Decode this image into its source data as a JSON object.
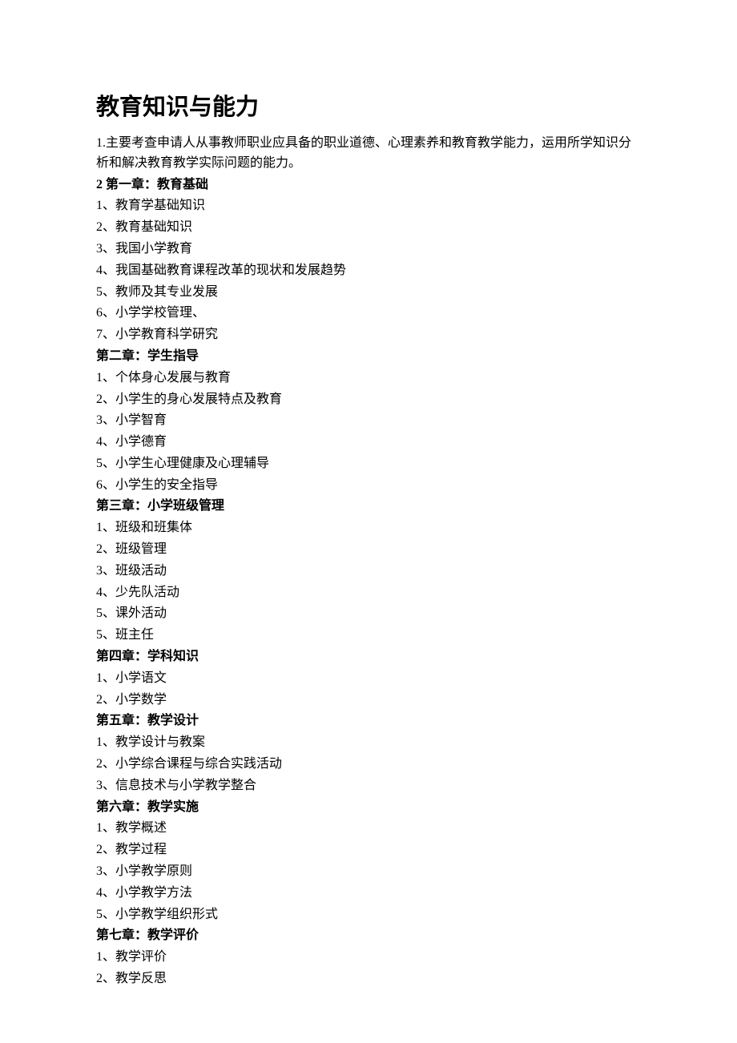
{
  "title": "教育知识与能力",
  "intro": "1.主要考查申请人从事教师职业应具备的职业道德、心理素养和教育教学能力，运用所学知识分析和解决教育教学实际问题的能力。",
  "chapters": [
    {
      "heading": "2 第一章：教育基础",
      "items": [
        "1、教育学基础知识",
        "2、教育基础知识",
        "3、我国小学教育",
        "4、我国基础教育课程改革的现状和发展趋势",
        "5、教师及其专业发展",
        "6、小学学校管理、",
        "7、小学教育科学研究"
      ]
    },
    {
      "heading": "第二章：学生指导",
      "items": [
        "1、个体身心发展与教育",
        "2、小学生的身心发展特点及教育",
        "3、小学智育",
        "4、小学德育",
        "5、小学生心理健康及心理辅导",
        "6、小学生的安全指导"
      ]
    },
    {
      "heading": "第三章：小学班级管理",
      "items": [
        "1、班级和班集体",
        "2、班级管理",
        "3、班级活动",
        "4、少先队活动",
        "5、课外活动",
        "5、班主任"
      ]
    },
    {
      "heading": "第四章：学科知识",
      "items": [
        "1、小学语文",
        "2、小学数学"
      ]
    },
    {
      "heading": "第五章：教学设计",
      "items": [
        "1、教学设计与教案",
        "2、小学综合课程与综合实践活动",
        "3、信息技术与小学教学整合"
      ]
    },
    {
      "heading": "第六章：教学实施",
      "items": [
        "1、教学概述",
        "2、教学过程",
        "3、小学教学原则",
        "4、小学教学方法",
        "5、小学教学组织形式"
      ]
    },
    {
      "heading": "第七章：教学评价",
      "items": [
        "1、教学评价",
        "2、教学反思"
      ]
    }
  ]
}
